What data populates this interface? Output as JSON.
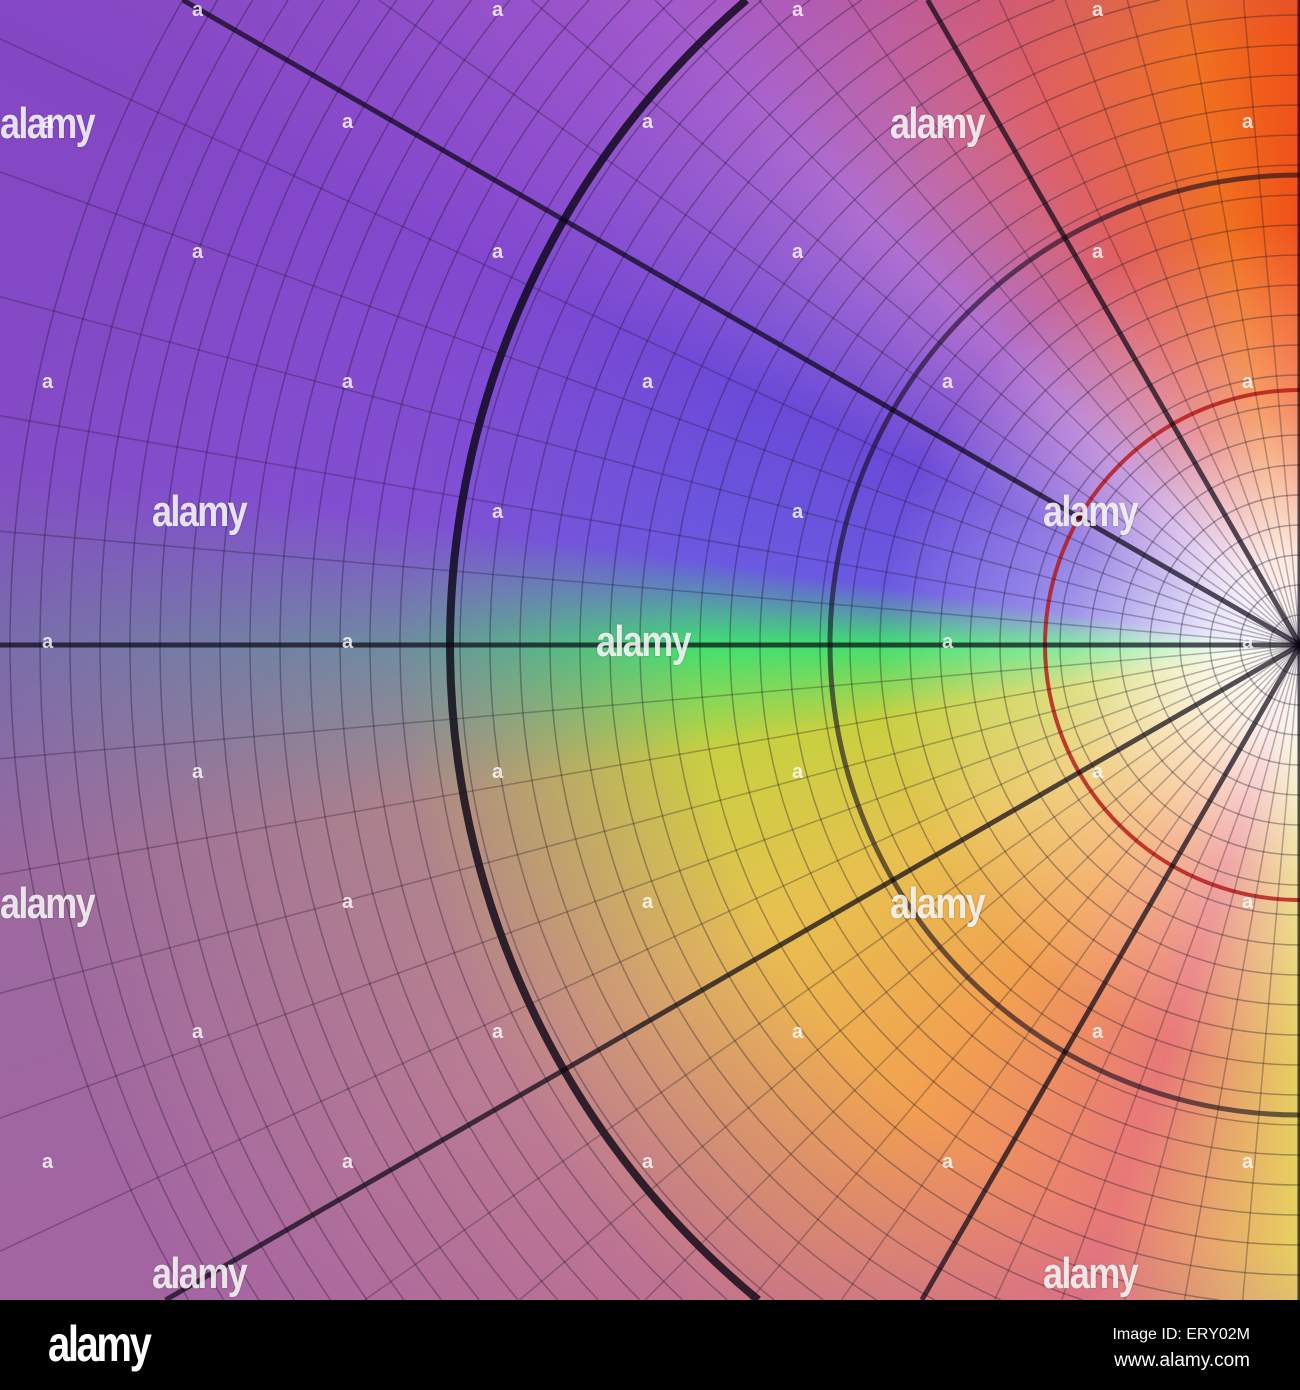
{
  "watermark": "alamy",
  "watermark_mark": "a",
  "footer": {
    "logo": "alamy",
    "image_id": "Image ID: ERY02M",
    "url": "www.alamy.com"
  },
  "colors": {
    "center": "#ffffff",
    "background_bar": "#000000"
  }
}
